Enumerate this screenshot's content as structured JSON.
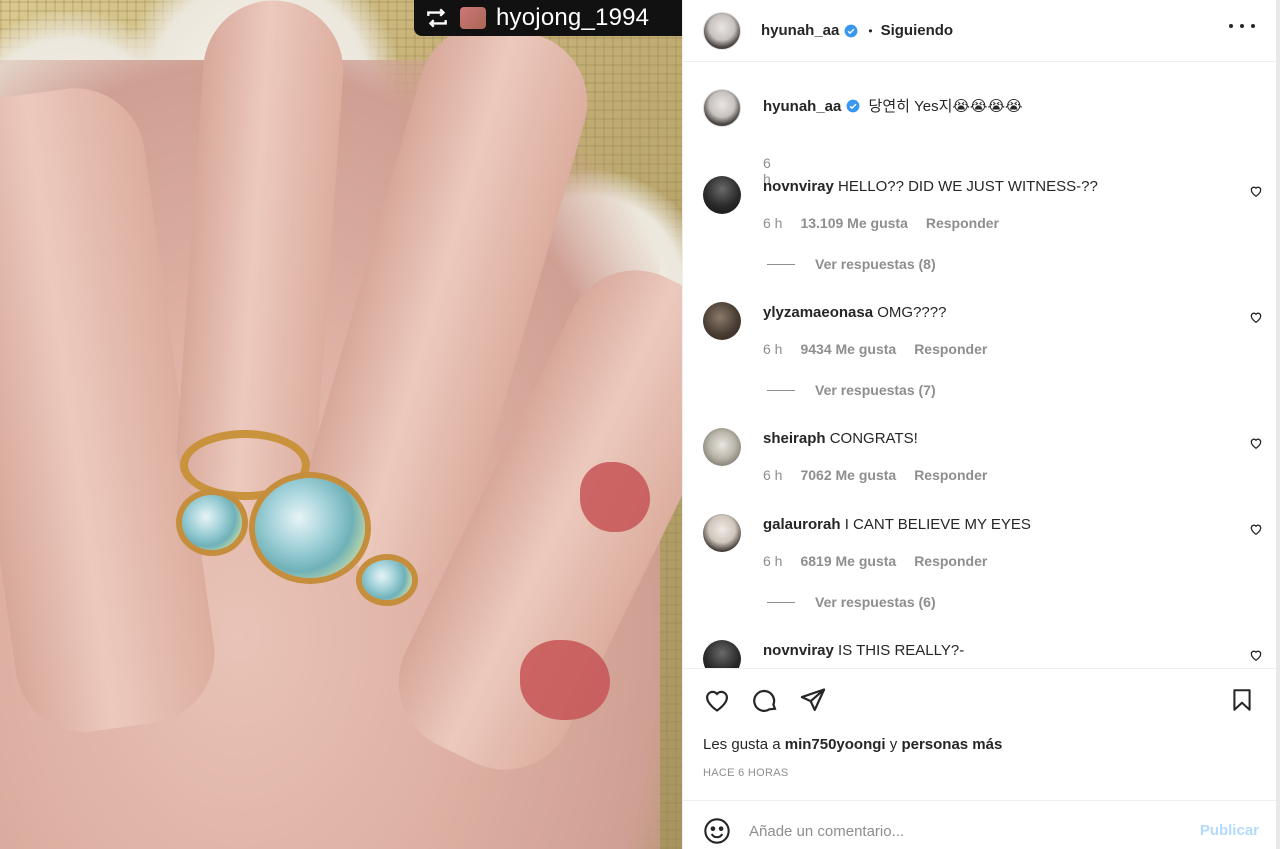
{
  "media": {
    "repost_username": "hyojong_1994",
    "repost_icon": "repost-icon"
  },
  "header": {
    "username": "hyunah_aa",
    "separator": "•",
    "follow_status": "Siguiendo",
    "verified": true
  },
  "caption": {
    "username": "hyunah_aa",
    "text": "당연히 Yes지😭😭😭😭",
    "time": "6 h"
  },
  "comments": [
    {
      "user": "novnviray",
      "text": "HELLO?? DID WE JUST WITNESS-??",
      "time": "6 h",
      "likes": "13.109 Me gusta",
      "reply": "Responder",
      "replies": "Ver respuestas (8)"
    },
    {
      "user": "ylyzamaeonasa",
      "text": "OMG????",
      "time": "6 h",
      "likes": "9434 Me gusta",
      "reply": "Responder",
      "replies": "Ver respuestas (7)"
    },
    {
      "user": "sheiraph",
      "text": "CONGRATS!",
      "time": "6 h",
      "likes": "7062 Me gusta",
      "reply": "Responder",
      "replies": ""
    },
    {
      "user": "galaurorah",
      "text": "I CANT BELIEVE MY EYES",
      "time": "6 h",
      "likes": "6819 Me gusta",
      "reply": "Responder",
      "replies": "Ver respuestas (6)"
    },
    {
      "user": "novnviray",
      "text": "IS THIS REALLY?-",
      "time": "",
      "likes": "",
      "reply": "",
      "replies": ""
    }
  ],
  "actions": {
    "likes_prefix": "Les gusta a",
    "liker": "min750yoongi",
    "likes_conj": "y",
    "likes_suffix": "personas más",
    "post_time": "HACE 6 HORAS"
  },
  "comment_bar": {
    "placeholder": "Añade un comentario...",
    "publish": "Publicar"
  },
  "colors": {
    "verified": "#3897f0",
    "publish_disabled": "#b3dbff",
    "secondary_text": "#8e8e8e"
  }
}
